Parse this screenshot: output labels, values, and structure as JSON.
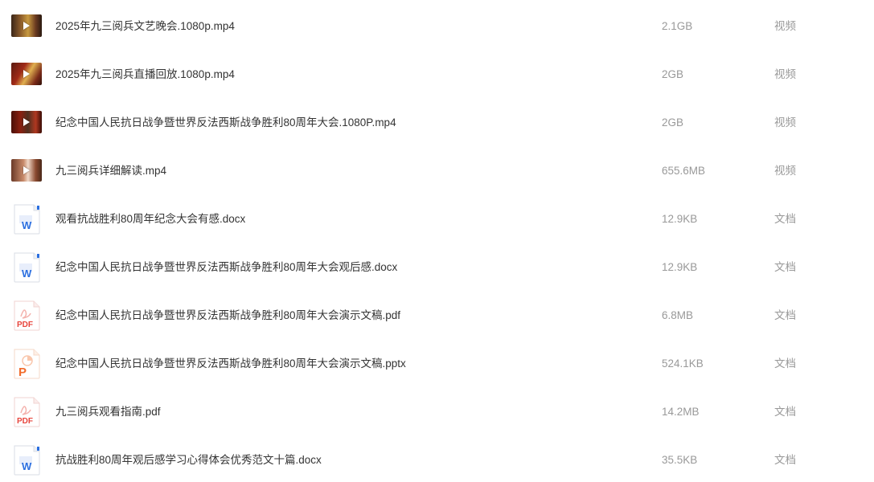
{
  "files": [
    {
      "name": "2025年九三阅兵文艺晚会.1080p.mp4",
      "size": "2.1GB",
      "type": "视频",
      "icon": "video-thumbnail-icon"
    },
    {
      "name": "2025年九三阅兵直播回放.1080p.mp4",
      "size": "2GB",
      "type": "视频",
      "icon": "video-thumbnail-icon"
    },
    {
      "name": "纪念中国人民抗日战争暨世界反法西斯战争胜利80周年大会.1080P.mp4",
      "size": "2GB",
      "type": "视频",
      "icon": "video-thumbnail-icon"
    },
    {
      "name": "九三阅兵详细解读.mp4",
      "size": "655.6MB",
      "type": "视频",
      "icon": "video-thumbnail-icon"
    },
    {
      "name": "观看抗战胜利80周年纪念大会有感.docx",
      "size": "12.9KB",
      "type": "文档",
      "icon": "word-doc-icon"
    },
    {
      "name": "纪念中国人民抗日战争暨世界反法西斯战争胜利80周年大会观后感.docx",
      "size": "12.9KB",
      "type": "文档",
      "icon": "word-doc-icon"
    },
    {
      "name": "纪念中国人民抗日战争暨世界反法西斯战争胜利80周年大会演示文稿.pdf",
      "size": "6.8MB",
      "type": "文档",
      "icon": "pdf-doc-icon"
    },
    {
      "name": "纪念中国人民抗日战争暨世界反法西斯战争胜利80周年大会演示文稿.pptx",
      "size": "524.1KB",
      "type": "文档",
      "icon": "ppt-doc-icon"
    },
    {
      "name": "九三阅兵观看指南.pdf",
      "size": "14.2MB",
      "type": "文档",
      "icon": "pdf-doc-icon"
    },
    {
      "name": "抗战胜利80周年观后感学习心得体会优秀范文十篇.docx",
      "size": "35.5KB",
      "type": "文档",
      "icon": "word-doc-icon"
    }
  ],
  "icon_labels": {
    "word": "W",
    "pdf": "PDF",
    "ppt": "P"
  },
  "colors": {
    "word": "#2b6fe0",
    "pdf": "#e8453c",
    "ppt": "#f26b2b",
    "text": "#333333",
    "muted": "#999999"
  }
}
